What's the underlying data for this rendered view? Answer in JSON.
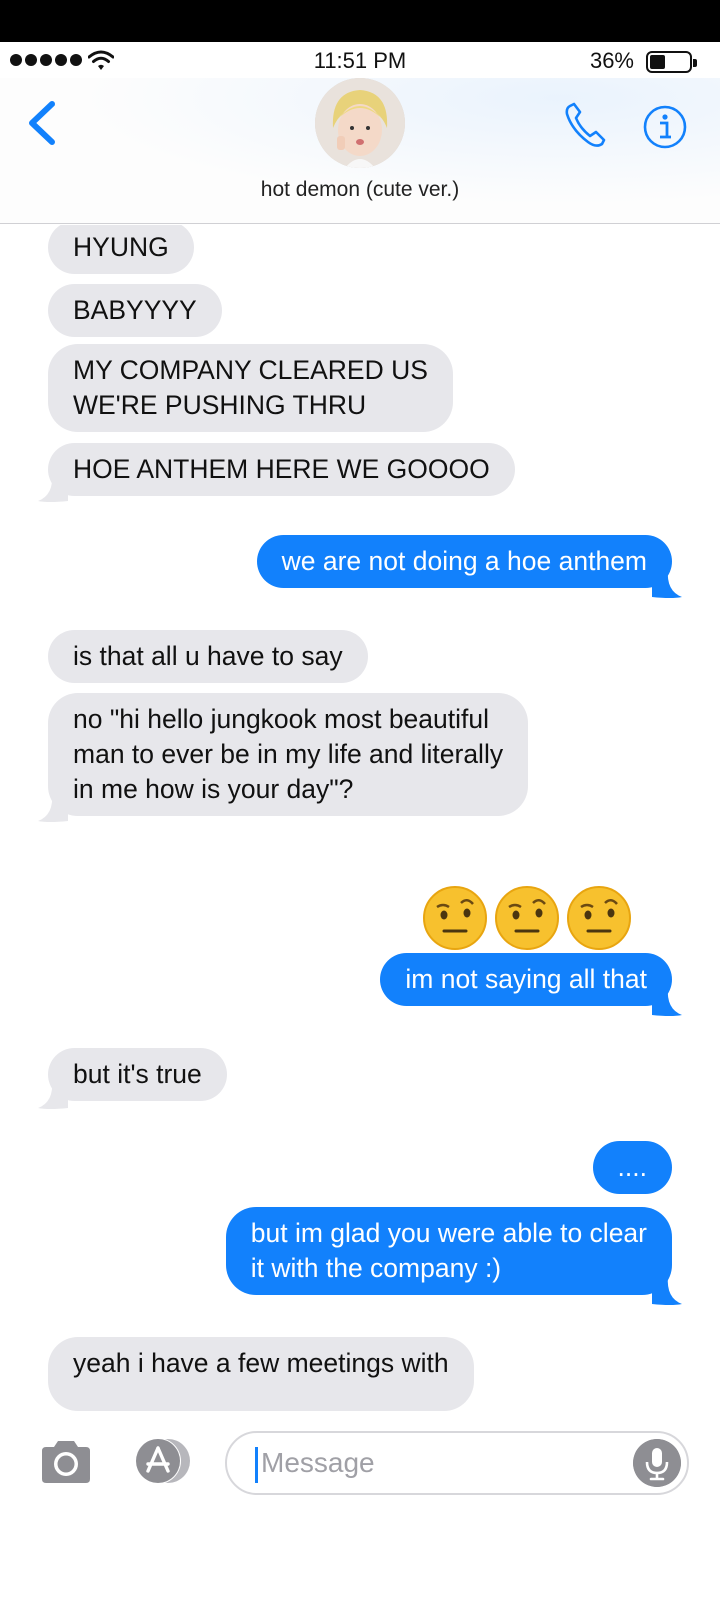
{
  "status_bar": {
    "time": "11:51 PM",
    "battery": "36%"
  },
  "header": {
    "contact_name": "hot demon (cute ver.)"
  },
  "messages": [
    {
      "from": "them",
      "text": "HYUNG"
    },
    {
      "from": "them",
      "text": "BABYYYY"
    },
    {
      "from": "them",
      "text": "MY COMPANY CLEARED US\nWE'RE PUSHING THRU"
    },
    {
      "from": "them",
      "text": "HOE ANTHEM HERE WE GOOOO"
    },
    {
      "from": "me",
      "text": "we are not doing a hoe anthem"
    },
    {
      "from": "them",
      "text": "is that all u have to say"
    },
    {
      "from": "them",
      "text": "no \"hi hello jungkook most beautiful\nman to ever be in my life and literally\nin me how is your day\"?"
    },
    {
      "from": "me",
      "text": "🤨🤨🤨",
      "emoji": "face-with-raised-eyebrow"
    },
    {
      "from": "me",
      "text": "im not saying all that"
    },
    {
      "from": "them",
      "text": "but it's true"
    },
    {
      "from": "me",
      "text": "...."
    },
    {
      "from": "me",
      "text": "but im glad you were able to clear\nit with the company :)"
    },
    {
      "from": "them",
      "text": "yeah i have a few meetings with"
    }
  ],
  "composer": {
    "placeholder": "Message"
  },
  "icons": {
    "back": "chevron-left-icon",
    "call": "phone-icon",
    "info": "info-icon",
    "camera": "camera-icon",
    "app_store": "app-store-icon",
    "mic": "microphone-icon"
  },
  "colors": {
    "sent_bubble": "#1281fc",
    "received_bubble": "#e7e7eb",
    "accent": "#1281fc"
  }
}
